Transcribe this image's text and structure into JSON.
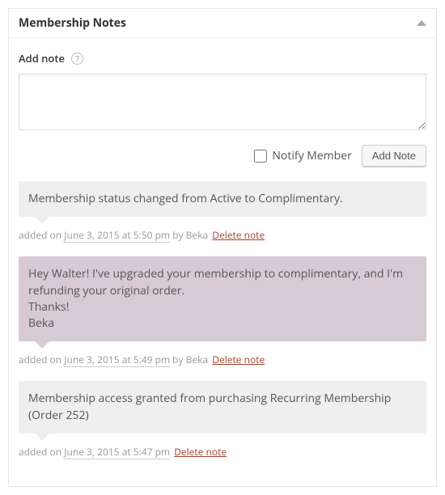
{
  "panel": {
    "title": "Membership Notes"
  },
  "add_note": {
    "label": "Add note",
    "help_symbol": "?",
    "textarea_value": "",
    "notify_label": "Notify Member",
    "button_label": "Add Note"
  },
  "meta_strings": {
    "added_on_prefix": "added on ",
    "by_prefix": " by ",
    "delete_label": "Delete note"
  },
  "notes": [
    {
      "type": "neutral",
      "body": "Membership status changed from Active to Complimentary.",
      "timestamp": "June 3, 2015 at 5:50 pm",
      "author": "Beka"
    },
    {
      "type": "customer",
      "body": "Hey Walter! I've upgraded your membership to complimentary, and I'm refunding your original order.\nThanks!\nBeka",
      "timestamp": "June 3, 2015 at 5:49 pm",
      "author": "Beka"
    },
    {
      "type": "neutral",
      "body": "Membership access granted from purchasing Recurring Membership (Order 252)",
      "timestamp": "June 3, 2015 at 5:47 pm",
      "author": null
    }
  ]
}
